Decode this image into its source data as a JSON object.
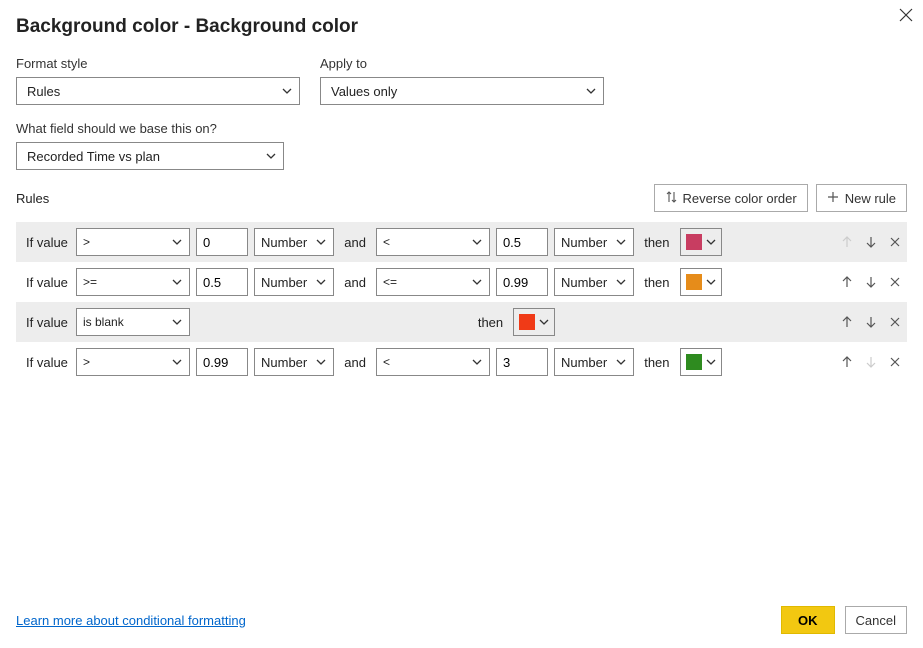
{
  "title": "Background color - Background color",
  "formatStyle": {
    "label": "Format style",
    "value": "Rules"
  },
  "applyTo": {
    "label": "Apply to",
    "value": "Values only"
  },
  "basedOn": {
    "label": "What field should we base this on?",
    "value": "Recorded Time vs plan"
  },
  "rulesLabel": "Rules",
  "reverseLabel": "Reverse color order",
  "newRuleLabel": "New rule",
  "ifValueLabel": "If value",
  "andLabel": "and",
  "thenLabel": "then",
  "numberLabel": "Number",
  "rules": [
    {
      "op1": ">",
      "v1": "0",
      "t1": "Number",
      "op2": "<",
      "v2": "0.5",
      "t2": "Number",
      "isBlank": false,
      "color": "#C83D61",
      "upDisabled": true,
      "downDisabled": false
    },
    {
      "op1": ">=",
      "v1": "0.5",
      "t1": "Number",
      "op2": "<=",
      "v2": "0.99",
      "t2": "Number",
      "isBlank": false,
      "color": "#E68C1A",
      "upDisabled": false,
      "downDisabled": false
    },
    {
      "op1": "is blank",
      "v1": "",
      "t1": "",
      "op2": "",
      "v2": "",
      "t2": "",
      "isBlank": true,
      "color": "#F03A17",
      "upDisabled": false,
      "downDisabled": false
    },
    {
      "op1": ">",
      "v1": "0.99",
      "t1": "Number",
      "op2": "<",
      "v2": "3",
      "t2": "Number",
      "isBlank": false,
      "color": "#2E8B1F",
      "upDisabled": false,
      "downDisabled": true
    }
  ],
  "learnMore": "Learn more about conditional formatting",
  "ok": "OK",
  "cancel": "Cancel"
}
